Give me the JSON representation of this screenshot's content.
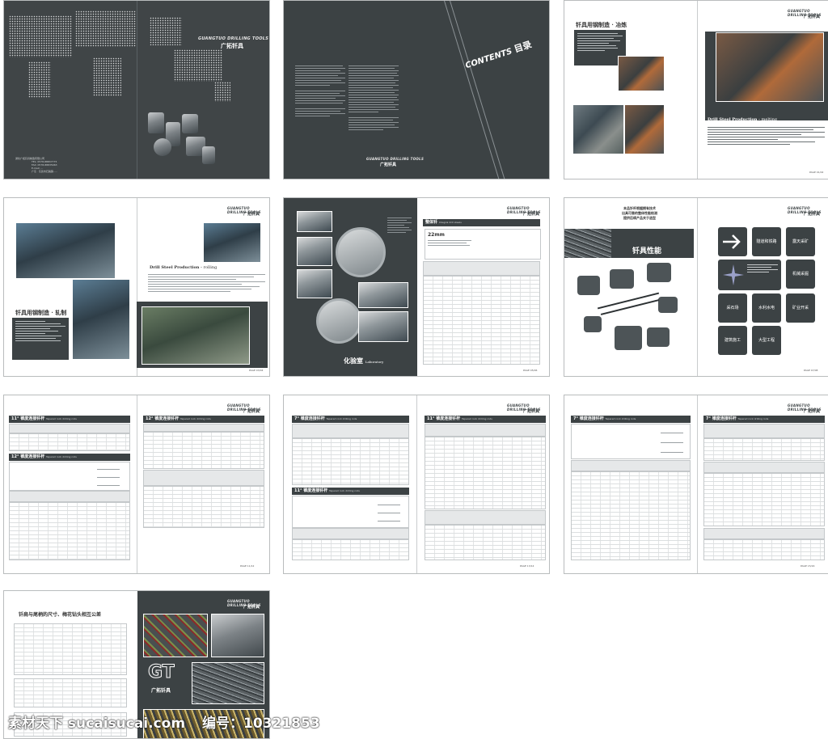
{
  "brand": {
    "en": "GUANGTUO DRILLING TOOLS",
    "cn": "广拓钎具"
  },
  "cover": {
    "contact_lines": [
      "通化广拓钎具制造有限公司",
      "TEL: 0578-88837775",
      "FAX: 0578-88835963",
      "E-mail: ...",
      "广东 · 东莞市石碣镇....."
    ]
  },
  "contents_page": {
    "title_en": "CONTENTS",
    "title_cn": "目录"
  },
  "smelting_page": {
    "title_cn": "钎具用钢制造 · 冶炼",
    "title_en": "Drill Steel Production",
    "title_en_suffix": "melting",
    "page_no": "PAGE 01/02"
  },
  "rolling_page": {
    "title_en": "Drill Steel Production",
    "title_en_suffix": "rolling",
    "title_cn": "钎具用钢制造 · 轧制",
    "page_no": "PAGE 03/04"
  },
  "lab_page": {
    "title_cn": "化验室",
    "title_en": "Laboratory",
    "table_title": "整体钎",
    "table_sub": "Integral drill steels",
    "size": "22mm",
    "page_no": "PAGE 05/06"
  },
  "performance_page": {
    "title_cn": "钎具性能",
    "intro_lines": [
      "本品钎杆根据拥有技术",
      "出具可靠的整体性能检测",
      "提供后续产品关于选型"
    ],
    "callouts": [
      "钎杆质料",
      "抗拉强度",
      "硬度",
      "冲击韧性",
      "疲劳强度",
      "耐磨性"
    ],
    "apps": [
      "隧道和铁路",
      "露天采矿",
      "机械采掘",
      "采石场",
      "水利水电",
      "矿业开采",
      "建筑施工",
      "大型工程"
    ],
    "page_no": "PAGE 07/08"
  },
  "table_pages": {
    "t11": "11°",
    "t12": "12°",
    "t7": "7°",
    "title": "锥度连接钎杆",
    "sub": "Tapered rock drilling rods",
    "page_nos": [
      "PAGE 11/12",
      "PAGE 13/14",
      "PAGE 15/16"
    ]
  },
  "back_page": {
    "title": "钎肩与尾柄的尺寸、梅花钻头相互公差",
    "gt": "GT",
    "cn": "广拓钎具"
  },
  "watermark": {
    "left": "素材天下 sucaisucai.com",
    "right": "编号：10321853"
  }
}
